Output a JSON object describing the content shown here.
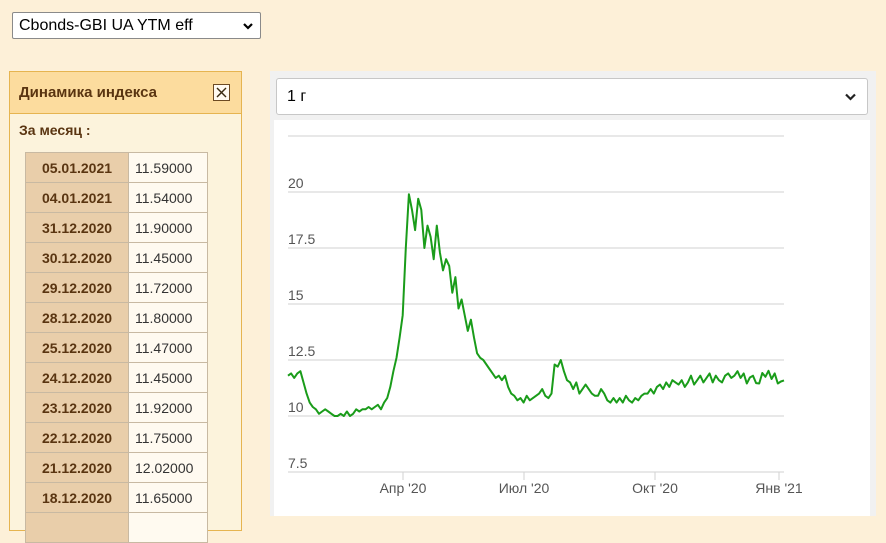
{
  "index_select": {
    "value": "Cbonds-GBI UA YTM eff"
  },
  "panel": {
    "title": "Динамика индекса",
    "month_label": "За месяц :",
    "rows": [
      {
        "date": "05.01.2021",
        "value": "11.59000"
      },
      {
        "date": "04.01.2021",
        "value": "11.54000"
      },
      {
        "date": "31.12.2020",
        "value": "11.90000"
      },
      {
        "date": "30.12.2020",
        "value": "11.45000"
      },
      {
        "date": "29.12.2020",
        "value": "11.72000"
      },
      {
        "date": "28.12.2020",
        "value": "11.80000"
      },
      {
        "date": "25.12.2020",
        "value": "11.47000"
      },
      {
        "date": "24.12.2020",
        "value": "11.45000"
      },
      {
        "date": "23.12.2020",
        "value": "11.92000"
      },
      {
        "date": "22.12.2020",
        "value": "11.75000"
      },
      {
        "date": "21.12.2020",
        "value": "12.02000"
      },
      {
        "date": "18.12.2020",
        "value": "11.65000"
      },
      {
        "date": "",
        "value": ""
      }
    ]
  },
  "period_select": {
    "value": "1 г"
  },
  "chart_data": {
    "type": "line",
    "x_ticks": [
      "Апр '20",
      "Июл '20",
      "Окт '20",
      "Янв '21"
    ],
    "y_ticks": [
      "7.5",
      "10",
      "12.5",
      "15",
      "17.5",
      "20"
    ],
    "ylim": [
      7.5,
      21.25
    ],
    "grid": true,
    "line_color": "#1a9c1a",
    "series": [
      {
        "values": [
          11.8,
          11.9,
          11.7,
          11.9,
          12.0,
          11.5,
          11.0,
          10.6,
          10.4,
          10.3,
          10.1,
          10.2,
          10.3,
          10.2,
          10.1,
          10.0,
          10.0,
          10.1,
          10.0,
          10.2,
          10.0,
          10.1,
          10.3,
          10.2,
          10.3,
          10.3,
          10.4,
          10.3,
          10.4,
          10.5,
          10.3,
          10.6,
          10.8,
          11.3,
          12.0,
          12.6,
          13.5,
          14.5,
          17.5,
          19.9,
          19.2,
          18.3,
          19.7,
          19.2,
          17.5,
          18.5,
          18.0,
          17.0,
          18.5,
          17.3,
          16.5,
          17.0,
          16.7,
          15.5,
          16.2,
          14.8,
          15.2,
          14.5,
          13.8,
          14.3,
          13.5,
          12.8,
          12.6,
          12.5,
          12.3,
          12.1,
          11.9,
          11.7,
          11.8,
          11.6,
          11.8,
          11.3,
          11.0,
          10.9,
          10.7,
          10.8,
          10.6,
          10.9,
          10.7,
          10.8,
          10.9,
          11.0,
          11.2,
          10.9,
          10.8,
          11.0,
          12.3,
          12.2,
          12.5,
          12.0,
          11.6,
          11.5,
          11.2,
          11.5,
          11.0,
          11.2,
          11.4,
          11.2,
          11.0,
          10.9,
          10.9,
          11.2,
          11.0,
          10.7,
          10.6,
          10.8,
          10.6,
          10.8,
          10.6,
          10.9,
          10.7,
          10.6,
          10.8,
          10.7,
          10.9,
          11.0,
          11.0,
          11.2,
          11.0,
          11.3,
          11.4,
          11.2,
          11.5,
          11.3,
          11.6,
          11.5,
          11.4,
          11.6,
          11.3,
          11.5,
          11.8,
          11.4,
          11.6,
          11.8,
          11.5,
          11.7,
          11.9,
          11.5,
          11.8,
          11.6,
          11.5,
          11.8,
          11.9,
          11.7,
          11.8,
          12.0,
          11.7,
          11.9,
          11.45,
          11.72,
          11.8,
          11.47,
          11.45,
          11.92,
          11.75,
          12.02,
          11.65,
          11.9,
          11.45,
          11.54,
          11.59
        ]
      }
    ]
  }
}
